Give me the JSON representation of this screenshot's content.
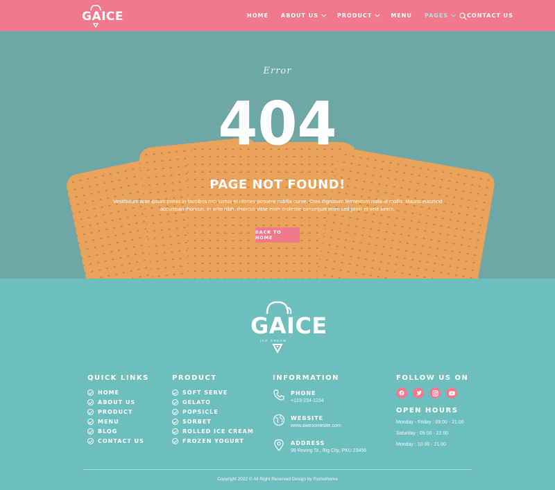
{
  "brand": {
    "name": "GAICE",
    "tagline": "ICE CREAM"
  },
  "nav": {
    "items": [
      {
        "label": "HOME",
        "dropdown": false,
        "active": false
      },
      {
        "label": "ABOUT US",
        "dropdown": true,
        "active": false
      },
      {
        "label": "PRODUCT",
        "dropdown": true,
        "active": false
      },
      {
        "label": "MENU",
        "dropdown": false,
        "active": false
      },
      {
        "label": "PAGES",
        "dropdown": true,
        "active": true
      },
      {
        "label": "CONTACT US",
        "dropdown": false,
        "active": false
      }
    ],
    "search_icon": "search-icon"
  },
  "hero": {
    "eyebrow": "Error",
    "code": "404",
    "title": "PAGE NOT FOUND!",
    "description": "Vestibulum ante ipsum primis in faucibus orci luctus et ultrices posuere cubilia curae. Cras dignissim fermentum nulla id mollis. Mauris euismod accumsan rhoncus. In ante nibh, rhoncus vitae enim molestie consequat enim sed proin et velit lorem.",
    "button": "BACK TO HOME"
  },
  "footer": {
    "quick_links": {
      "title": "QUICK LINKS",
      "items": [
        "HOME",
        "ABOUT US",
        "PRODUCT",
        "MENU",
        "BLOG",
        "CONTACT US"
      ]
    },
    "product": {
      "title": "PRODUCT",
      "items": [
        "SOFT SERVE",
        "GELATO",
        "POPSICLE",
        "SORBET",
        "ROLLED ICE CREAM",
        "FROZEN YOGURT"
      ]
    },
    "information": {
      "title": "INFORMATION",
      "items": [
        {
          "icon": "phone-icon",
          "label": "PHONE",
          "value": "+123-234-1234"
        },
        {
          "icon": "globe-icon",
          "label": "WEBSITE",
          "value": "www.awesomesite.com"
        },
        {
          "icon": "map-pin-icon",
          "label": "ADDRESS",
          "value": "99 Roving St., Big City, PKU 23456"
        }
      ]
    },
    "follow": {
      "title": "FOLLOW US ON",
      "socials": [
        "facebook-icon",
        "twitter-icon",
        "instagram-icon",
        "youtube-icon"
      ]
    },
    "hours": {
      "title": "OPEN HOURS",
      "lines": [
        "Monday - Friday : 09.00 - 21.00",
        "Saturday : 09.00 - 22.00",
        "Monday : 10.00 - 21.00"
      ]
    },
    "copyright": "Copyright 2022 © All Right Reserved Design by Rometheme"
  },
  "colors": {
    "nav": "#f07a8c",
    "accent": "#f07a8c",
    "footer": "#6dbfbd",
    "hero_bg": "#6ea8a6",
    "active_nav": "#aee3e2"
  }
}
